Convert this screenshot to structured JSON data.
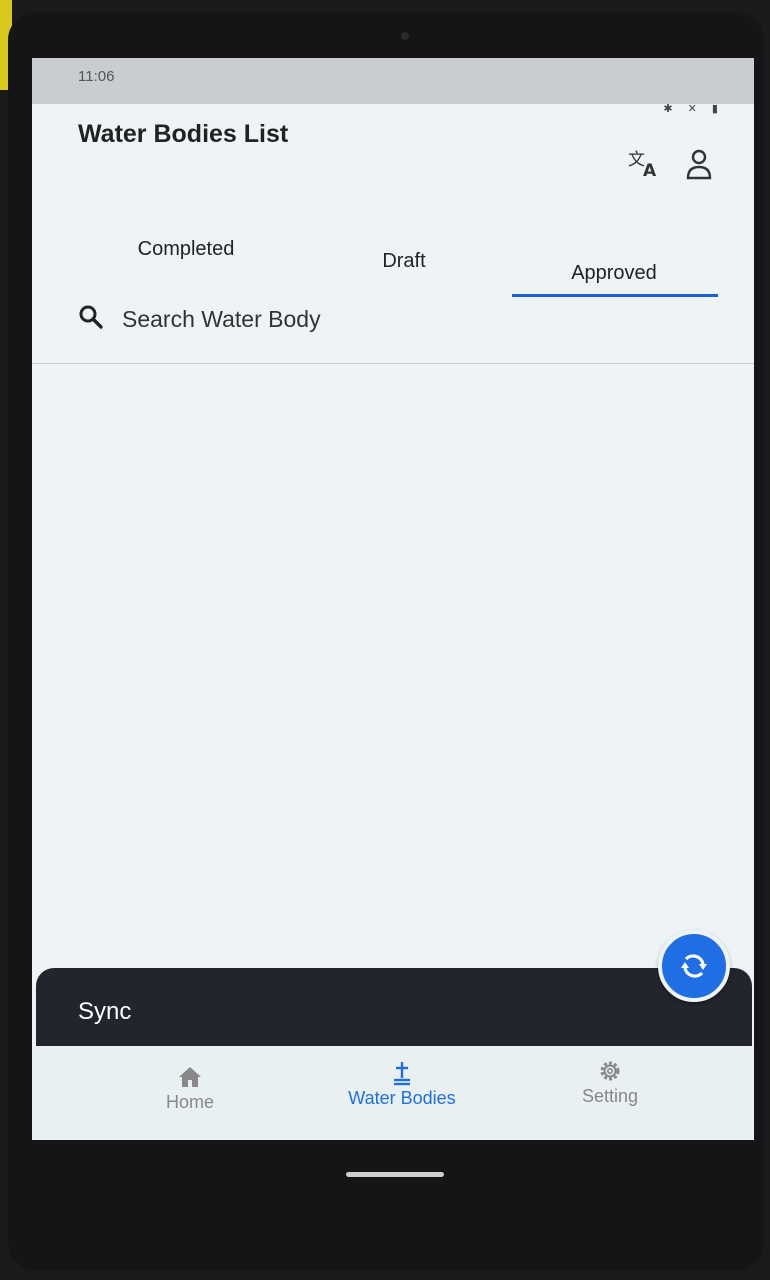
{
  "status_bar": {
    "time": "11:06",
    "icons": "✱ ✕ ▮"
  },
  "app_bar": {
    "title": "Water Bodies List",
    "translate_icon": "translate-icon",
    "account_icon": "account-icon"
  },
  "tabs": [
    {
      "label": "Completed",
      "selected": false
    },
    {
      "label": "Draft",
      "selected": false
    },
    {
      "label": "Approved",
      "selected": true
    }
  ],
  "search": {
    "placeholder": "Search Water Body",
    "value": ""
  },
  "snackbar": {
    "text": "Sync"
  },
  "fab": {
    "icon": "sync-icon"
  },
  "bottom_nav": [
    {
      "label": "Home",
      "icon": "home-icon",
      "active": false
    },
    {
      "label": "Water Bodies",
      "icon": "water-bodies-icon",
      "active": true
    },
    {
      "label": "Setting",
      "icon": "gear-icon",
      "active": false
    }
  ],
  "colors": {
    "accent": "#1f6ee6",
    "snackbar_bg": "#22252d",
    "screen_bg": "#eef4f5"
  }
}
